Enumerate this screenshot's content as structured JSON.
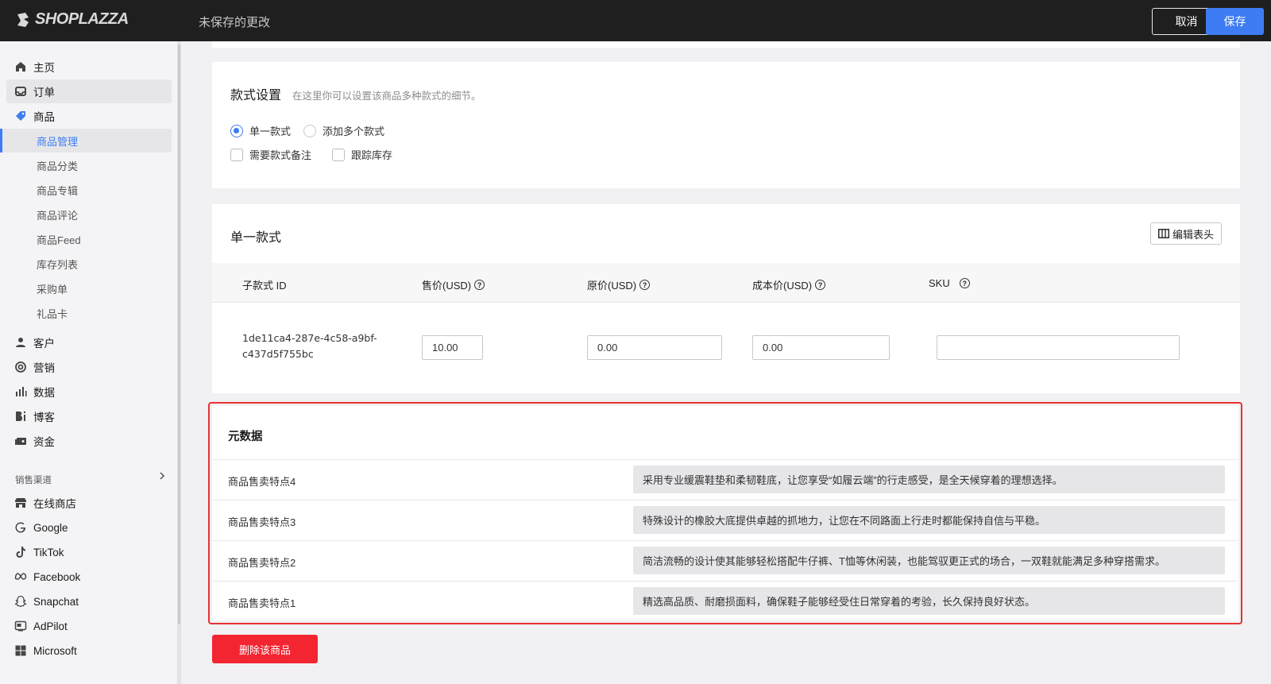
{
  "topbar": {
    "logo_text": "SHOPLAZZA",
    "unsaved_text": "未保存的更改",
    "cancel_label": "取消",
    "save_label": "保存"
  },
  "sidebar": {
    "items": [
      {
        "label": "主页",
        "icon": "home-icon"
      },
      {
        "label": "订单",
        "icon": "inbox-icon"
      },
      {
        "label": "商品",
        "icon": "tag-icon"
      }
    ],
    "product_sub": [
      {
        "label": "商品管理"
      },
      {
        "label": "商品分类"
      },
      {
        "label": "商品专辑"
      },
      {
        "label": "商品评论"
      },
      {
        "label": "商品Feed"
      },
      {
        "label": "库存列表"
      },
      {
        "label": "采购单"
      },
      {
        "label": "礼品卡"
      }
    ],
    "items2": [
      {
        "label": "客户",
        "icon": "person-icon"
      },
      {
        "label": "营销",
        "icon": "target-icon"
      },
      {
        "label": "数据",
        "icon": "bar-chart-icon"
      },
      {
        "label": "博客",
        "icon": "blog-icon"
      },
      {
        "label": "资金",
        "icon": "wallet-icon"
      }
    ],
    "channels_label": "销售渠道",
    "channels": [
      {
        "label": "在线商店",
        "icon": "store-icon"
      },
      {
        "label": "Google",
        "icon": "google-icon"
      },
      {
        "label": "TikTok",
        "icon": "tiktok-icon"
      },
      {
        "label": "Facebook",
        "icon": "meta-icon"
      },
      {
        "label": "Snapchat",
        "icon": "snapchat-icon"
      },
      {
        "label": "AdPilot",
        "icon": "adpilot-icon"
      },
      {
        "label": "Microsoft",
        "icon": "microsoft-icon"
      }
    ]
  },
  "variant_settings": {
    "title": "款式设置",
    "hint": "在这里你可以设置该商品多种款式的细节。",
    "radio_single": "单一款式",
    "radio_multi": "添加多个款式",
    "check_note": "需要款式备注",
    "check_track": "跟踪库存"
  },
  "single_variant": {
    "title": "单一款式",
    "edit_header_label": "编辑表头",
    "columns": [
      "子款式 ID",
      "售价(USD)",
      "原价(USD)",
      "成本价(USD)",
      "SKU"
    ],
    "row": {
      "variant_id_line1": "1de11ca4-287e-4c58-a9bf-",
      "variant_id_line2": "c437d5f755bc",
      "price": "10.00",
      "compare_price": "0.00",
      "cost_price": "0.00",
      "sku": ""
    }
  },
  "metadata": {
    "title": "元数据",
    "rows": [
      {
        "key": "商品售卖特点4",
        "value": "采用专业缓震鞋垫和柔韧鞋底，让您享受“如履云端”的行走感受，是全天候穿着的理想选择。"
      },
      {
        "key": "商品售卖特点3",
        "value": "特殊设计的橡胶大底提供卓越的抓地力，让您在不同路面上行走时都能保持自信与平稳。"
      },
      {
        "key": "商品售卖特点2",
        "value": "简洁流畅的设计使其能够轻松搭配牛仔裤、T恤等休闲装，也能驾驭更正式的场合，一双鞋就能满足多种穿搭需求。"
      },
      {
        "key": "商品售卖特点1",
        "value": "精选高品质、耐磨损面料，确保鞋子能够经受住日常穿着的考验，长久保持良好状态。"
      }
    ]
  },
  "delete_label": "删除该商品",
  "colors": {
    "accent": "#3d7cf3",
    "danger": "#f22531",
    "highlight_border": "#e8322f"
  }
}
